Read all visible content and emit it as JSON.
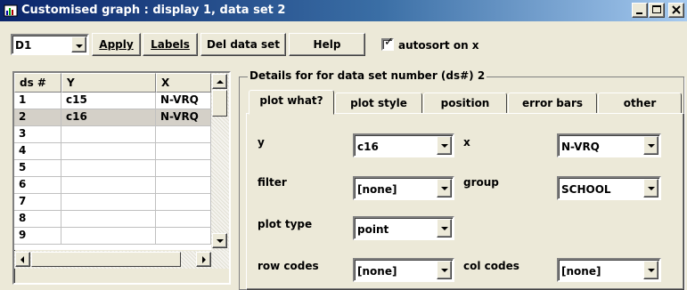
{
  "window": {
    "title": "Customised graph : display 1, data set 2",
    "title_color": "#0a246a"
  },
  "toolbar": {
    "display_select": "D1",
    "apply_label": "Apply",
    "labels_label": "Labels",
    "del_label": "Del data set",
    "help_label": "Help",
    "autosort_label": "autosort on x",
    "autosort_checked": true
  },
  "grid": {
    "columns": [
      "ds #",
      "Y",
      "X"
    ],
    "rows": [
      {
        "ds": "1",
        "y": "c15",
        "x": "N-VRQ"
      },
      {
        "ds": "2",
        "y": "c16",
        "x": "N-VRQ"
      },
      {
        "ds": "3",
        "y": "",
        "x": ""
      },
      {
        "ds": "4",
        "y": "",
        "x": ""
      },
      {
        "ds": "5",
        "y": "",
        "x": ""
      },
      {
        "ds": "6",
        "y": "",
        "x": ""
      },
      {
        "ds": "7",
        "y": "",
        "x": ""
      },
      {
        "ds": "8",
        "y": "",
        "x": ""
      },
      {
        "ds": "9",
        "y": "",
        "x": ""
      }
    ],
    "selected_row": 2
  },
  "details": {
    "legend": "Details for for data set number (ds#) 2",
    "tabs": [
      "plot what?",
      "plot style",
      "position",
      "error bars",
      "other"
    ],
    "active_tab": "plot what?",
    "fields": {
      "y_label": "y",
      "y_value": "c16",
      "x_label": "x",
      "x_value": "N-VRQ",
      "filter_label": "filter",
      "filter_value": "[none]",
      "group_label": "group",
      "group_value": "SCHOOL",
      "plot_type_label": "plot type",
      "plot_type_value": "point",
      "row_codes_label": "row codes",
      "row_codes_value": "[none]",
      "col_codes_label": "col codes",
      "col_codes_value": "[none]"
    }
  },
  "icons": {
    "window_icon": "graph-window-icon",
    "minimize": "minimize-icon",
    "maximize": "maximize-icon",
    "close": "close-icon"
  }
}
